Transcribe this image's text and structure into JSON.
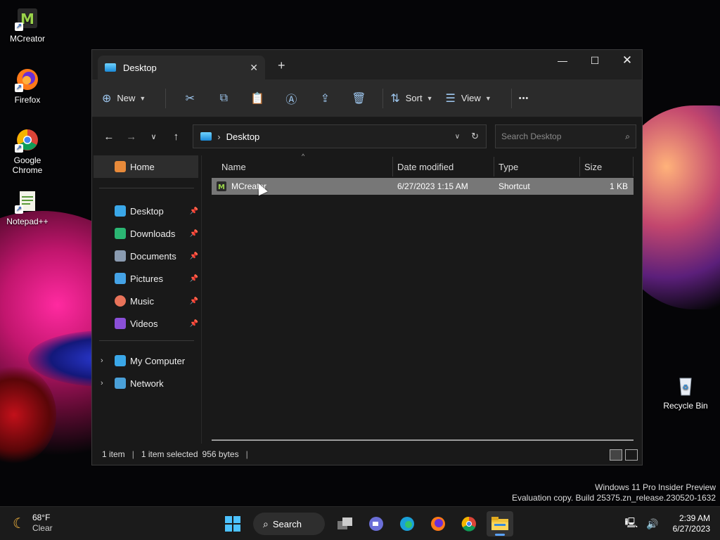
{
  "desktop": {
    "icons": [
      {
        "label": "MCreator",
        "icon": "mcreator-icon"
      },
      {
        "label": "Firefox",
        "icon": "firefox-icon"
      },
      {
        "label": "Google Chrome",
        "icon": "chrome-icon"
      },
      {
        "label": "Notepad++",
        "icon": "notepadpp-icon"
      },
      {
        "label": "Recycle Bin",
        "icon": "recycle-bin-icon"
      }
    ]
  },
  "explorer": {
    "tab_title": "Desktop",
    "new_tab_glyph": "+",
    "toolbar": {
      "new_label": "New",
      "sort_label": "Sort",
      "view_label": "View",
      "more_glyph": "•••"
    },
    "address": {
      "path": "Desktop",
      "search_placeholder": "Search Desktop"
    },
    "sidebar": {
      "home": "Home",
      "pinned": [
        {
          "label": "Desktop",
          "color": "#3aa7e8"
        },
        {
          "label": "Downloads",
          "color": "#2bb673"
        },
        {
          "label": "Documents",
          "color": "#8a9bb0"
        },
        {
          "label": "Pictures",
          "color": "#45a3e6"
        },
        {
          "label": "Music",
          "color": "#e8735a"
        },
        {
          "label": "Videos",
          "color": "#8a4fd8"
        }
      ],
      "locations": [
        {
          "label": "My Computer"
        },
        {
          "label": "Network"
        }
      ]
    },
    "columns": [
      "Name",
      "Date modified",
      "Type",
      "Size"
    ],
    "files": [
      {
        "name": "MCreator",
        "date_modified": "6/27/2023 1:15 AM",
        "type": "Shortcut",
        "size": "1 KB"
      }
    ],
    "status": {
      "items": "1 item",
      "selected": "1 item selected",
      "bytes": "956 bytes"
    }
  },
  "watermark": {
    "line1": "Windows 11 Pro Insider Preview",
    "line2": "Evaluation copy. Build 25375.zn_release.230520-1632"
  },
  "taskbar": {
    "weather_temp": "68°F",
    "weather_cond": "Clear",
    "search_label": "Search",
    "time": "2:39 AM",
    "date": "6/27/2023"
  }
}
